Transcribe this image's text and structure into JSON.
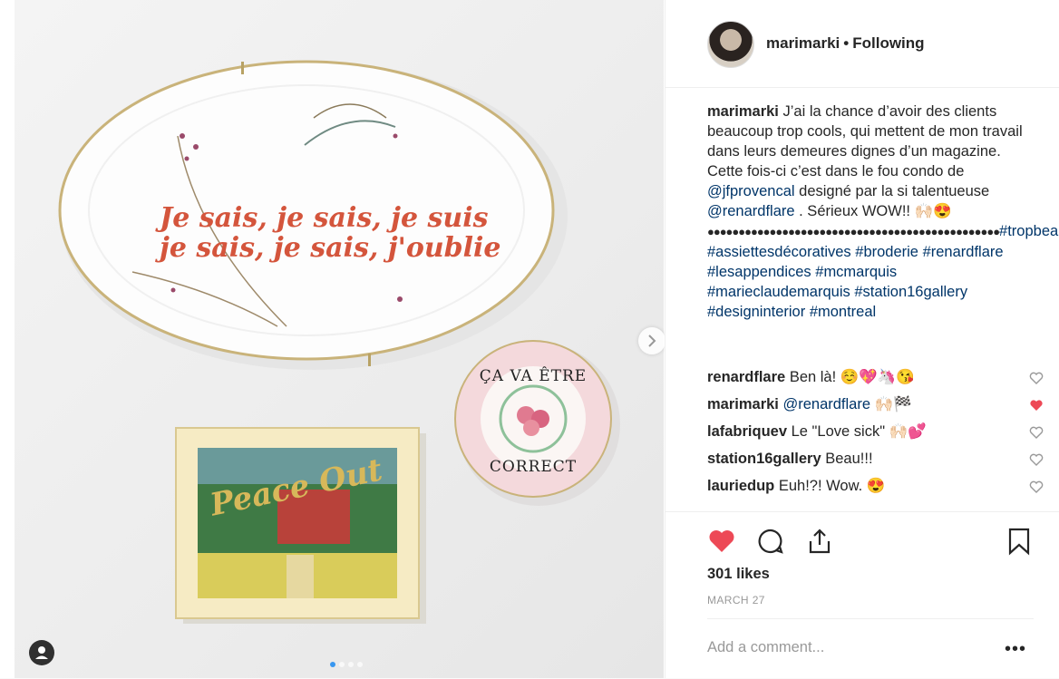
{
  "post": {
    "username": "marimarki",
    "follow_status": "Following",
    "caption_user": "marimarki",
    "caption_text_1": "J’ai la chance d’avoir des clients beaucoup trop cools, qui mettent de mon travail dans leurs demeures dignes d’un magazine. Cette fois-ci c’est dans le fou condo de",
    "mention_1": "@jfprovencal",
    "caption_text_2": "designé par la si talentueuse",
    "mention_2": "@renardflare",
    "caption_text_3": ". Sérieux WOW!! 🙌🏻😍",
    "dots_line": "●●●●●●●●●●●●●●●●●●●●●●●●●●●●●●●●●●●●●●●●●●●●●●●",
    "hashtags": [
      "#tropbeaudesign",
      "#assiettesdécoratives",
      "#broderie",
      "#renardflare",
      "#lesappendices",
      "#mcmarquis",
      "#marieclaudemarquis",
      "#station16gallery",
      "#designinterior",
      "#montreal"
    ],
    "likes": "301 likes",
    "date": "MARCH 27",
    "add_comment_placeholder": "Add a comment...",
    "more_label": "•••"
  },
  "comments": [
    {
      "user": "renardflare",
      "text": "Ben là! ☺️💖🦄😘",
      "liked": false
    },
    {
      "user": "marimarki",
      "text": "@renardflare 🙌🏻🏁",
      "liked": true
    },
    {
      "user": "lafabriquev",
      "text": "Le \"Love sick\" 🙌🏻💕",
      "liked": false
    },
    {
      "user": "station16gallery",
      "text": "Beau!!!",
      "liked": false
    },
    {
      "user": "lauriedup",
      "text": "Euh!?! Wow. 😍",
      "liked": false
    }
  ],
  "photo": {
    "plate_text_line1": "Je sais, je sais, je suis",
    "plate_text_line2": "je sais, je sais, j'oublie",
    "small_plate_top": "ÇA VA ÊTRE",
    "small_plate_bottom": "CORRECT",
    "frame_text": "Peace Out"
  },
  "colors": {
    "heart_red": "#ed4956",
    "link_blue": "#003569",
    "accent_blue": "#3897f0"
  }
}
